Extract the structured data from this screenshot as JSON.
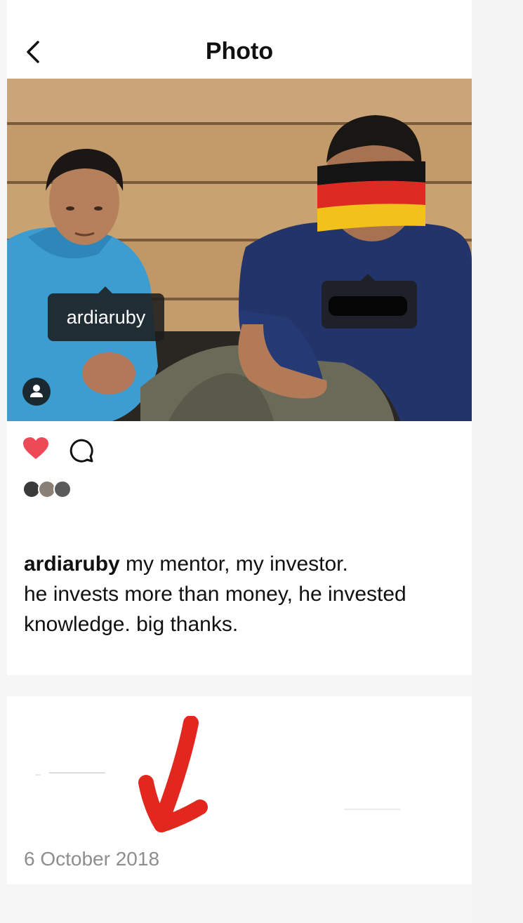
{
  "header": {
    "title": "Photo",
    "back_icon": "chevron-left-icon"
  },
  "photo": {
    "tags": [
      {
        "username": "ardiaruby"
      },
      {
        "username": ""
      }
    ],
    "tagged_people_icon": "person-icon",
    "overlay": "germany-flag"
  },
  "actions": {
    "like_icon": "heart-filled-icon",
    "like_color": "#ed4956",
    "comment_icon": "comment-bubble-icon"
  },
  "likers": {
    "avatars": [
      "liker-avatar-1",
      "liker-avatar-2",
      "liker-avatar-3"
    ]
  },
  "caption": {
    "username": "ardiaruby",
    "line1": " my mentor, my investor.",
    "line2": "he invests more than money, he invested",
    "line3": "knowledge. big thanks."
  },
  "post": {
    "date": "6 October 2018"
  },
  "annotation": {
    "arrow_color": "#e2281e"
  }
}
